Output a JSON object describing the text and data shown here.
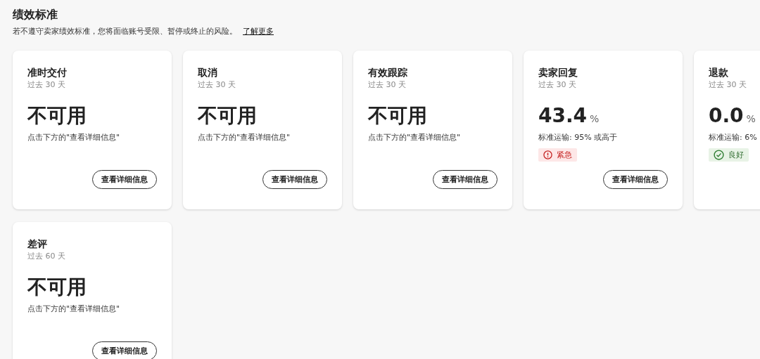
{
  "header": {
    "title": "绩效标准",
    "description": "若不遵守卖家绩效标准，您将面临账号受限、暂停或终止的风险。",
    "link": "了解更多"
  },
  "cards": [
    {
      "title": "准时交付",
      "period": "过去 30 天",
      "value": "不可用",
      "note": "点击下方的\"查看详细信息\"",
      "button": "查看详细信息"
    },
    {
      "title": "取消",
      "period": "过去 30 天",
      "value": "不可用",
      "note": "点击下方的\"查看详细信息\"",
      "button": "查看详细信息"
    },
    {
      "title": "有效跟踪",
      "period": "过去 30 天",
      "value": "不可用",
      "note": "点击下方的\"查看详细信息\"",
      "button": "查看详细信息"
    },
    {
      "title": "卖家回复",
      "period": "过去 30 天",
      "value": "43.4",
      "unit": "%",
      "note": "标准运输: 95% 或高于",
      "status": {
        "kind": "urgent",
        "label": "紧急"
      },
      "button": "查看详细信息"
    },
    {
      "title": "退款",
      "period": "过去 30 天",
      "value": "0.0",
      "unit": "%",
      "note": "标准运输: 6%",
      "status": {
        "kind": "good",
        "label": "良好"
      }
    },
    {
      "title": "差评",
      "period": "过去 60 天",
      "value": "不可用",
      "note": "点击下方的\"查看详细信息\"",
      "button": "查看详细信息"
    }
  ]
}
